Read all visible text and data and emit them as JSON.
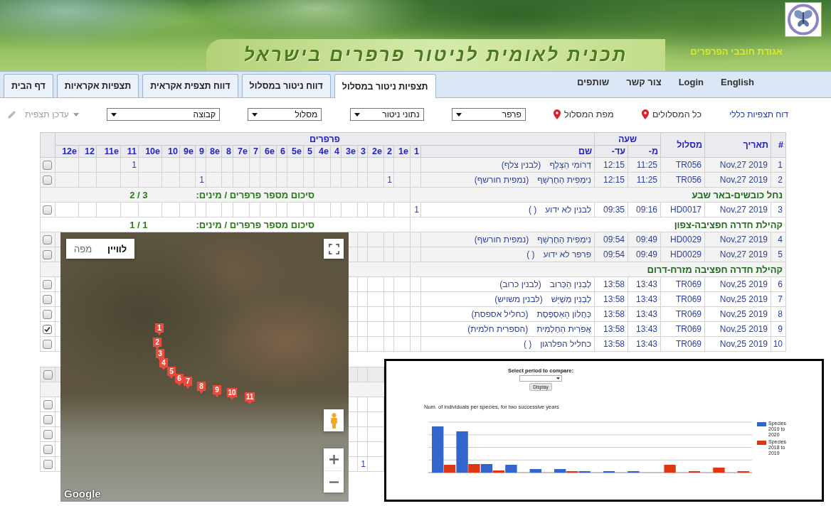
{
  "header": {
    "organization": "אגודת חובבי הפרפרים",
    "title": "תכנית לאומית לניטור פרפרים בישראל"
  },
  "nav": {
    "links": [
      "English",
      "Login",
      "צור קשר",
      "שותפים"
    ],
    "tabs": [
      {
        "label": "תצפיות ניטור במסלול",
        "selected": true
      },
      {
        "label": "דווח ניטור במסלול",
        "selected": false
      },
      {
        "label": "דווח תצפית אקראית",
        "selected": false
      },
      {
        "label": "תצפיות אקראיות",
        "selected": false
      },
      {
        "label": "דף הבית",
        "selected": false
      }
    ]
  },
  "filters": {
    "report_link": "דוח תצפיות כללי",
    "map_links": [
      "כל המסלולים",
      "מפת המסלול"
    ],
    "selects": [
      "פרפר",
      "נתוני ניטור",
      "מסלול",
      "קבוצה"
    ],
    "update_button": {
      "label": "עדכן תצפית",
      "disabled": true
    }
  },
  "table": {
    "columns": [
      "#",
      "תאריך",
      "מסלול"
    ],
    "time_header": "שעה",
    "time_columns": [
      "מ-",
      "עד-"
    ],
    "butterflies_header": "פרפרים",
    "name_column": "שם",
    "count_columns": [
      "1",
      "1e",
      "2",
      "2e",
      "3",
      "3e",
      "4",
      "4e",
      "5",
      "5e",
      "6",
      "6e",
      "7",
      "7e",
      "8",
      "8e",
      "9",
      "9e",
      "10",
      "10e",
      "11",
      "11e",
      "12",
      "12e"
    ],
    "rows": [
      {
        "kind": "observation",
        "number": "1",
        "date": "Nov,27 2019",
        "route": "TR056",
        "from": "11:25",
        "to": "12:15",
        "species": "דְּרוֹמִי הַצָּלָף",
        "species_plain": "(לבנין צלף)",
        "count_11": "1",
        "checked": false
      },
      {
        "kind": "observation",
        "number": "2",
        "date": "Nov,27 2019",
        "route": "TR056",
        "from": "11:25",
        "to": "12:15",
        "species": "נִימְפִית הַחֻרְשָׁף",
        "species_plain": "(נמפית חורשף)",
        "count_2": "1",
        "count_9": "1",
        "checked": false
      },
      {
        "kind": "group",
        "title": "נחל כובשים-באר שבע",
        "summary_label": "סיכום מספר פרפרים / מינים:",
        "summary_value": "3 / 2"
      },
      {
        "kind": "observation",
        "number": "3",
        "date": "Nov,27 2019",
        "route": "HD0017",
        "from": "09:16",
        "to": "09:35",
        "species": "לבנין לא ידוע",
        "species_plain": "( )",
        "count_1": "1",
        "checked": false
      },
      {
        "kind": "group",
        "title": "קהילת חדרה חפציבה-צפון",
        "summary_label": "סיכום מספר פרפרים / מינים:",
        "summary_value": "1 / 1"
      },
      {
        "kind": "observation",
        "number": "4",
        "date": "Nov,27 2019",
        "route": "HD0029",
        "from": "09:49",
        "to": "09:54",
        "species": "נִימְפִית הַחֻרְשָׁף",
        "species_plain": "(נמפית חורשף)",
        "checked": false
      },
      {
        "kind": "observation",
        "number": "5",
        "date": "Nov,27 2019",
        "route": "HD0029",
        "from": "09:49",
        "to": "09:54",
        "species": "פרפר לא ידוע",
        "species_plain": "( )",
        "checked": false
      },
      {
        "kind": "group",
        "title": "קהילת חדרה חפציבה מזרח-דרום"
      },
      {
        "kind": "observation",
        "number": "6",
        "date": "Nov,25 2019",
        "route": "TR069",
        "from": "13:43",
        "to": "13:58",
        "species": "לְבְנִין הַכְּרוּב",
        "species_plain": "(לבנין כרוב)",
        "checked": false
      },
      {
        "kind": "observation",
        "number": "7",
        "date": "Nov,25 2019",
        "route": "TR069",
        "from": "13:43",
        "to": "13:58",
        "species": "לְבְנִין מְשֻׁיָּשׁ",
        "species_plain": "(לבנין משויש)",
        "checked": false
      },
      {
        "kind": "observation",
        "number": "8",
        "date": "Nov,25 2019",
        "route": "TR069",
        "from": "13:43",
        "to": "13:58",
        "species": "כְּחֲלוֹן הָאַסְפֶּסֶת",
        "species_plain": "(כחליל אספסת)",
        "checked": false
      },
      {
        "kind": "observation",
        "number": "9",
        "date": "Nov,25 2019",
        "route": "TR069",
        "from": "13:43",
        "to": "13:58",
        "species": "אֲפֹרִית הַחֶלְמִית",
        "species_plain": "(הספרית חלמית)",
        "checked": true
      },
      {
        "kind": "observation",
        "number": "10",
        "date": "Nov,25 2019",
        "route": "TR069",
        "from": "13:43",
        "to": "13:58",
        "species": "כחליל הפלרגון",
        "species_plain": "( )",
        "checked": false
      }
    ]
  },
  "second_table": {
    "rows": [
      {
        "kind": "header",
        "checked": false
      },
      {
        "kind": "group"
      },
      {
        "kind": "observation",
        "checked": false
      },
      {
        "kind": "observation",
        "checked": false
      },
      {
        "kind": "observation",
        "checked": false
      },
      {
        "kind": "observation",
        "checked": false
      },
      {
        "kind": "observation",
        "checked": false,
        "count_3": "1"
      }
    ]
  },
  "map": {
    "map_types": [
      {
        "label": "לוויין",
        "selected": true
      },
      {
        "label": "מפה",
        "selected": false
      }
    ],
    "markers": [
      {
        "label": "1"
      },
      {
        "label": "2"
      },
      {
        "label": "3"
      },
      {
        "label": "4"
      },
      {
        "label": "5"
      },
      {
        "label": "6"
      },
      {
        "label": "7"
      },
      {
        "label": "8"
      },
      {
        "label": "9"
      },
      {
        "label": "10"
      },
      {
        "label": "11"
      }
    ],
    "logo": "Google"
  },
  "chart_window": {
    "compare_label": "Select period to compare:",
    "display_button": "Display",
    "title": "Num. of individuals per species, for two successive years",
    "legend": [
      {
        "label": "Species 2019 to 2020",
        "color": "#3366cc"
      },
      {
        "label": "Species 2018 to 2019",
        "color": "#dc3912"
      }
    ]
  }
}
